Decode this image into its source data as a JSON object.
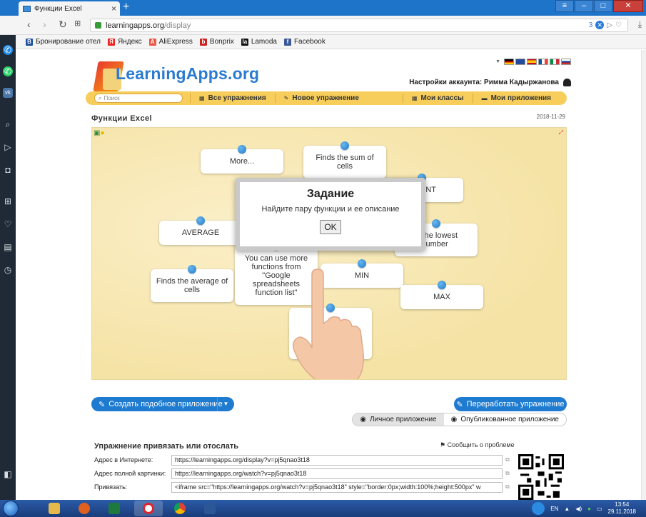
{
  "browser": {
    "tab_title": "Функции Excel",
    "url_host": "learningapps.org",
    "url_path": "/display",
    "badge_count": "3"
  },
  "bookmarks": [
    {
      "label": "Бронирование отел",
      "color": "#1d4f9c",
      "icon": "B"
    },
    {
      "label": "Яндекс",
      "color": "#e22",
      "icon": "Я"
    },
    {
      "label": "AliExpress",
      "color": "#e54",
      "icon": "A"
    },
    {
      "label": "Bonprix",
      "color": "#c22",
      "icon": "b"
    },
    {
      "label": "Lamoda",
      "color": "#111",
      "icon": "la"
    },
    {
      "label": "Facebook",
      "color": "#3b5998",
      "icon": "f"
    }
  ],
  "site": {
    "logo": "LearningApps.org",
    "account_label": "Настройки аккаунта: Римма Кадыржанова",
    "search_placeholder": "Поиск",
    "nav": [
      "Все упражнения",
      "Новое упражнение",
      "Мои классы",
      "Мои приложения"
    ],
    "page_title": "Функции Excel",
    "date": "2018-11-29"
  },
  "cards": [
    {
      "text": "More..."
    },
    {
      "text": "Finds the sum of cells"
    },
    {
      "text": "UNT"
    },
    {
      "text": "AVERAGE"
    },
    {
      "text": "ns the lowest number"
    },
    {
      "text": "You can use more functions from \"Google spreadsheets function list\""
    },
    {
      "text": "MIN"
    },
    {
      "text": "Finds the average of cells"
    },
    {
      "text": "MAX"
    },
    {
      "text": "n"
    }
  ],
  "dialog": {
    "title": "Задание",
    "text": "Найдите пару функции и ее описание",
    "ok": "OK"
  },
  "actions": {
    "create": "Создать подобное приложение",
    "rework": "Переработать упражнение",
    "private": "Личное приложение",
    "published": "Опубликованное приложение"
  },
  "embed": {
    "title": "Упражнение привязать или отослать",
    "report": "Сообщить о проблеме",
    "rows": [
      {
        "label": "Адрес в Интернете:",
        "value": "https://learningapps.org/display?v=pj5qnao3t18"
      },
      {
        "label": "Адрес полной картинки:",
        "value": "https://learningapps.org/watch?v=pj5qnao3t18"
      },
      {
        "label": "Привязать:",
        "value": "<iframe src=\"https://learningapps.org/watch?v=pj5qnao3t18\" style=\"border:0px;width:100%;height:500px\" w"
      }
    ]
  },
  "taskbar": {
    "lang": "EN",
    "time": "13:54",
    "date": "29.11.2018"
  }
}
